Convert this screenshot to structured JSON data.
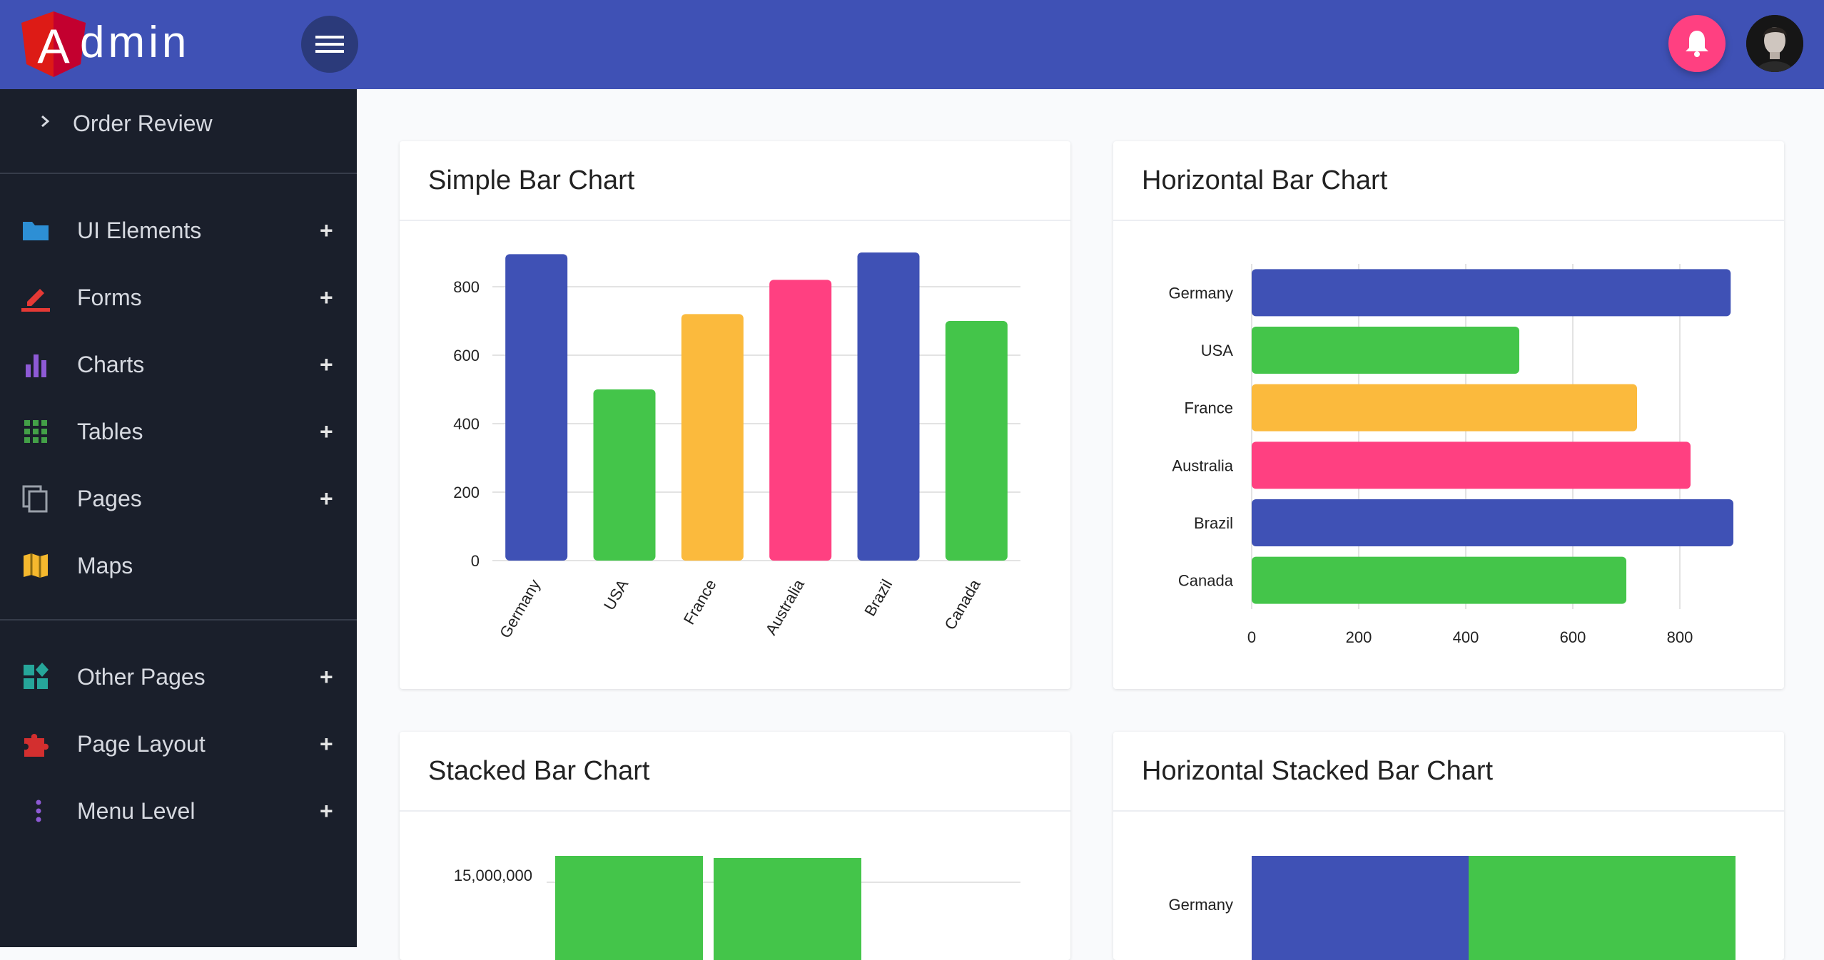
{
  "header": {
    "logo_letter": "A",
    "logo_rest": "dmin",
    "menu_icon": "hamburger-icon",
    "bell_icon": "bell-icon"
  },
  "sidebar": {
    "order_review": "Order Review",
    "items": [
      {
        "label": "UI Elements",
        "icon": "folder-icon",
        "color": "#2d8fd5",
        "expand": "+"
      },
      {
        "label": "Forms",
        "icon": "pencil-icon",
        "color": "#e53935",
        "expand": "+"
      },
      {
        "label": "Charts",
        "icon": "bar-chart-icon",
        "color": "#8e5ad6",
        "expand": "+"
      },
      {
        "label": "Tables",
        "icon": "grid-icon",
        "color": "#43a047",
        "expand": "+"
      },
      {
        "label": "Pages",
        "icon": "copy-icon",
        "color": "#9aa0aa",
        "expand": "+"
      },
      {
        "label": "Maps",
        "icon": "map-icon",
        "color": "#f5b82e",
        "expand": ""
      }
    ],
    "items2": [
      {
        "label": "Other Pages",
        "icon": "widgets-icon",
        "color": "#26a69a",
        "expand": "+"
      },
      {
        "label": "Page Layout",
        "icon": "puzzle-icon",
        "color": "#d32f2f",
        "expand": "+"
      },
      {
        "label": "Menu Level",
        "icon": "more-vert-icon",
        "color": "#8e5ad6",
        "expand": "+"
      }
    ]
  },
  "colors": {
    "blue": "#3f51b5",
    "green": "#44c54a",
    "yellow": "#fbba3d",
    "pink": "#ff4081"
  },
  "chart_data": [
    {
      "type": "bar",
      "title": "Simple Bar Chart",
      "categories": [
        "Germany",
        "USA",
        "France",
        "Australia",
        "Brazil",
        "Canada"
      ],
      "values": [
        895,
        500,
        720,
        820,
        900,
        700
      ],
      "yticks": [
        "0",
        "200",
        "400",
        "600",
        "800"
      ],
      "ylim": [
        0,
        900
      ]
    },
    {
      "type": "bar",
      "orientation": "horizontal",
      "title": "Horizontal Bar Chart",
      "categories": [
        "Germany",
        "USA",
        "France",
        "Australia",
        "Brazil",
        "Canada"
      ],
      "values": [
        895,
        500,
        720,
        820,
        900,
        700
      ],
      "xticks": [
        "0",
        "200",
        "400",
        "600",
        "800"
      ],
      "xlim": [
        0,
        900
      ]
    },
    {
      "type": "bar",
      "stacked": true,
      "title": "Stacked Bar Chart",
      "yticks": [
        "15,000,000"
      ]
    },
    {
      "type": "bar",
      "stacked": true,
      "orientation": "horizontal",
      "title": "Horizontal Stacked Bar Chart",
      "categories": [
        "Germany"
      ]
    }
  ]
}
